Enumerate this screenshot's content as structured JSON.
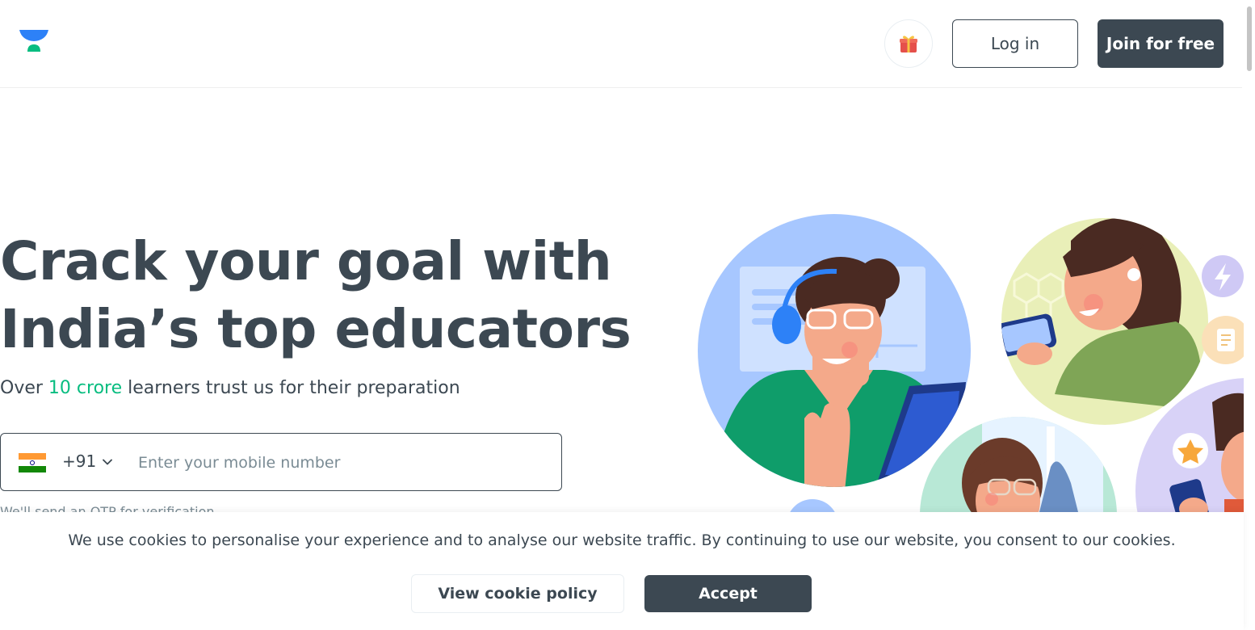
{
  "header": {
    "gift_icon": "gift-icon",
    "login_label": "Log in",
    "join_label": "Join for free"
  },
  "hero": {
    "title_line1": "Crack your goal with",
    "title_line2": "India’s top educators",
    "subtitle_prefix": "Over ",
    "subtitle_highlight": "10 crore",
    "subtitle_suffix": " learners trust us for their preparation"
  },
  "phone_form": {
    "country_code": "+91",
    "flag_icon": "india-flag-icon",
    "placeholder": "Enter your mobile number",
    "value": "",
    "note": "We'll send an OTP for verification"
  },
  "cookie_banner": {
    "text": "We use cookies to personalise your experience and to analyse our website traffic. By continuing to use our website, you consent to our cookies.",
    "policy_label": "View cookie policy",
    "accept_label": "Accept"
  },
  "colors": {
    "primary_dark": "#3c4852",
    "accent_green": "#08bd80",
    "logo_blue": "#2d81f7"
  }
}
